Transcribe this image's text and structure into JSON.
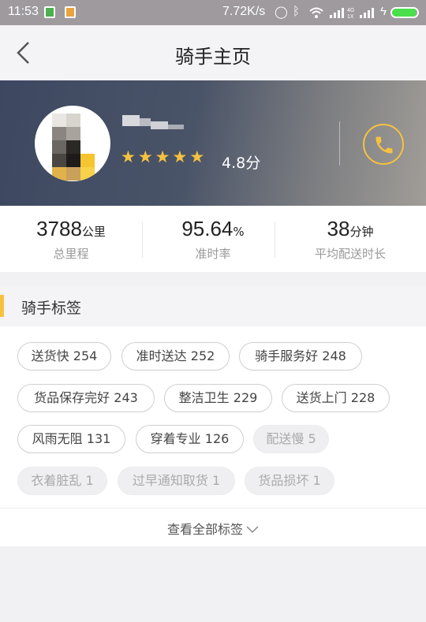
{
  "status_bar": {
    "time": "11:53",
    "network_speed": "7.72K/s",
    "icons": [
      "sync-icon",
      "bluetooth-icon",
      "wifi-icon",
      "signal-4g-icon",
      "signal-icon",
      "charging-icon",
      "battery-icon"
    ],
    "battery_level": 0.95
  },
  "nav": {
    "title": "骑手主页"
  },
  "rider": {
    "star_count": 5,
    "rating": "4.8分",
    "accent": "#f6c23e"
  },
  "stats": [
    {
      "value": "3788",
      "unit": "公里",
      "label": "总里程"
    },
    {
      "value": "95.64",
      "unit": "%",
      "label": "准时率"
    },
    {
      "value": "38",
      "unit": "分钟",
      "label": "平均配送时长"
    }
  ],
  "tags_section": {
    "title": "骑手标签",
    "tags": [
      {
        "text": "送货快 254",
        "active": true
      },
      {
        "text": "准时送达 252",
        "active": true
      },
      {
        "text": "骑手服务好 248",
        "active": true
      },
      {
        "text": "货品保存完好 243",
        "active": true
      },
      {
        "text": "整洁卫生 229",
        "active": true
      },
      {
        "text": "送货上门 228",
        "active": true
      },
      {
        "text": "风雨无阻 131",
        "active": true
      },
      {
        "text": "穿着专业 126",
        "active": true
      },
      {
        "text": "配送慢 5",
        "active": false
      },
      {
        "text": "衣着脏乱 1",
        "active": false
      },
      {
        "text": "过早通知取货 1",
        "active": false
      },
      {
        "text": "货品损坏 1",
        "active": false
      }
    ],
    "view_all": "查看全部标签"
  }
}
